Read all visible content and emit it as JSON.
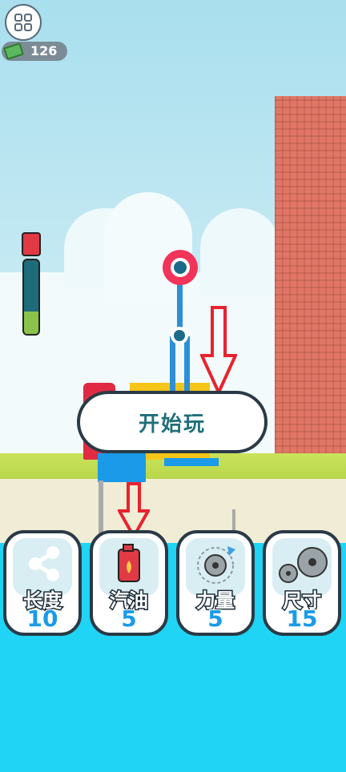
{
  "hud": {
    "money": "126",
    "fuel_level": 0.3
  },
  "start_button": {
    "label": "开始玩"
  },
  "upgrades": [
    {
      "label": "长度",
      "value": "10",
      "icon": "share-nodes-icon"
    },
    {
      "label": "汽油",
      "value": "5",
      "icon": "fuel-can-icon"
    },
    {
      "label": "力量",
      "value": "5",
      "icon": "saw-rotate-icon"
    },
    {
      "label": "尺寸",
      "value": "15",
      "icon": "saw-blades-icon"
    }
  ],
  "colors": {
    "accent_blue": "#1b9be8",
    "saw_red": "#f2335a",
    "tower_brick": "#e07766",
    "ocean": "#1fd4f5",
    "arrow_red": "#e8232e"
  }
}
